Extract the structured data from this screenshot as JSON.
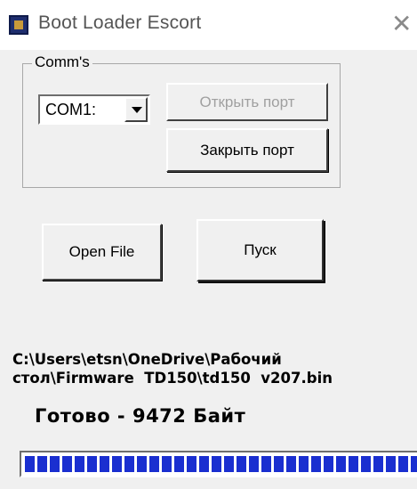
{
  "window": {
    "title": "Boot Loader Escort",
    "close_glyph": "✕"
  },
  "comms": {
    "legend": "Comm's",
    "port_value": "COM1:",
    "open_port_label": "Открыть порт",
    "close_port_label": "Закрыть порт"
  },
  "actions": {
    "open_file_label": "Open File",
    "start_label": "Пуск"
  },
  "file_path": "C:\\Users\\etsn\\OneDrive\\Рабочий\nстол\\Firmware  TD150\\td150  v207.bin",
  "status": "Готово - 9472 Байт",
  "progress": {
    "fraction": 1.0,
    "color": "#1a2fd0"
  },
  "icons": {
    "app": "app-icon",
    "close": "close-icon",
    "dropdown": "chevron-down-icon"
  }
}
